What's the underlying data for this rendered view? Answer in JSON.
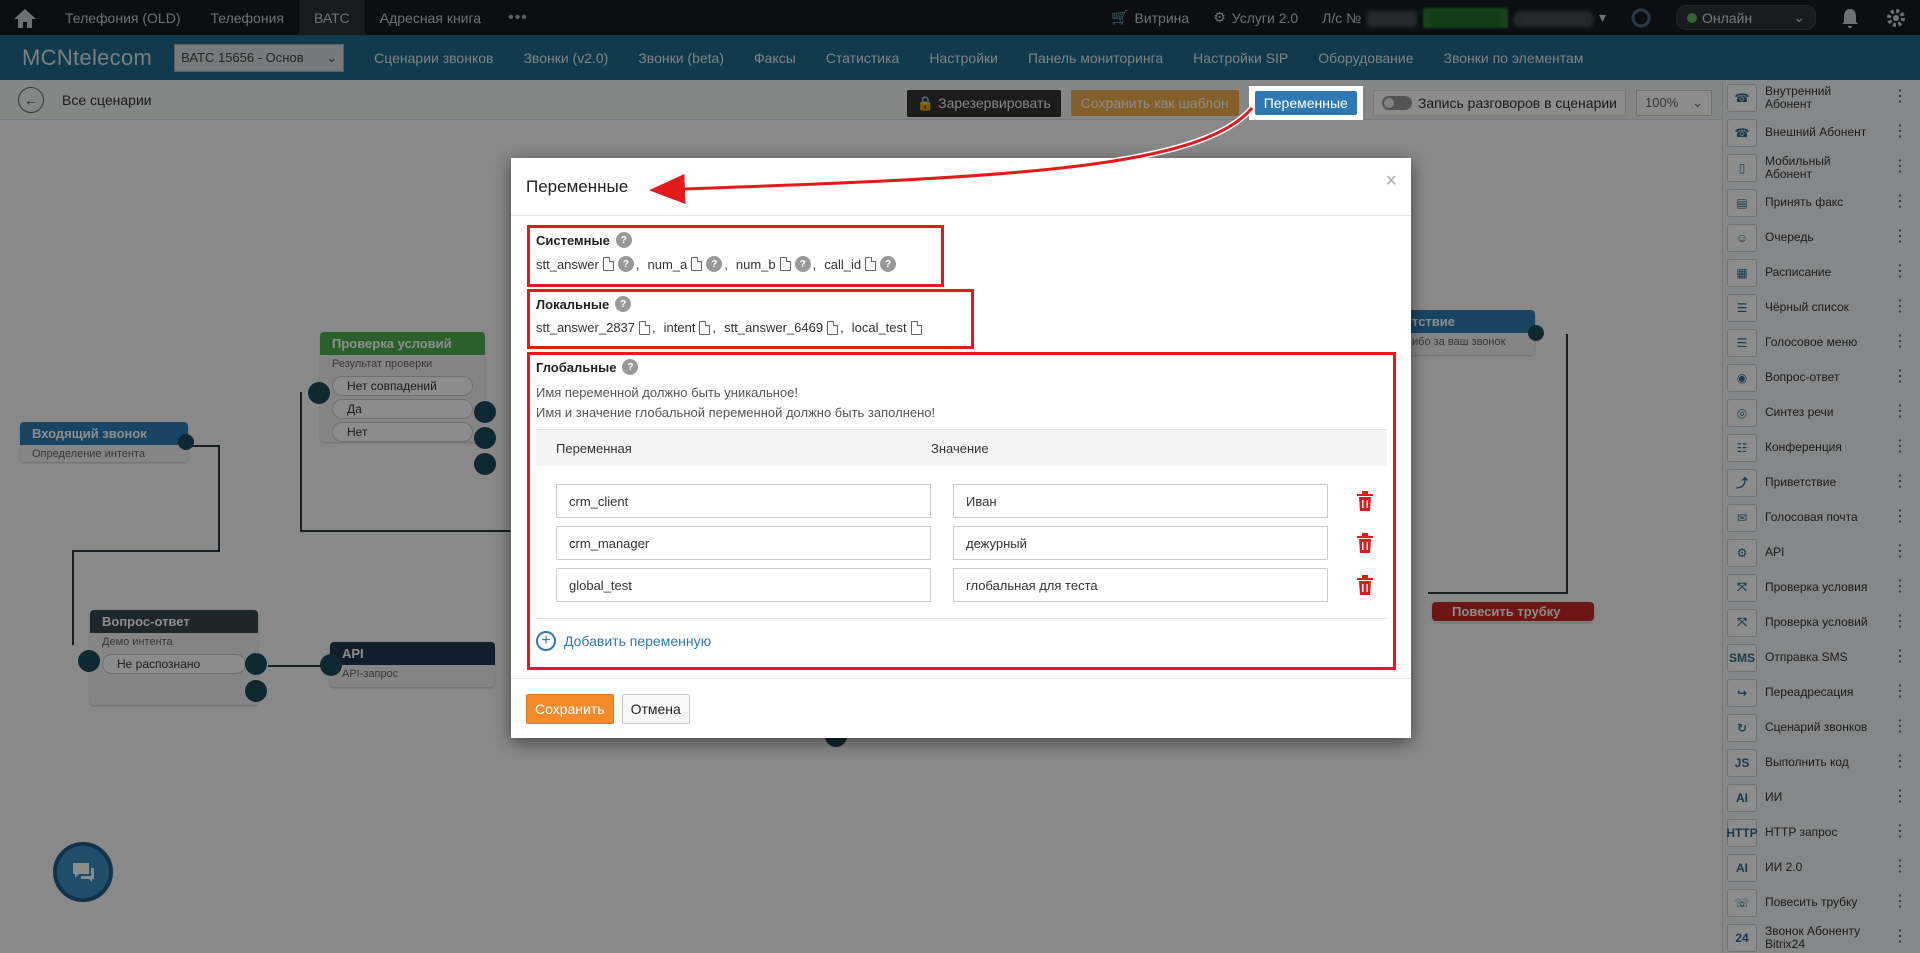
{
  "topbar": {
    "tabs": [
      "Телефония (OLD)",
      "Телефония",
      "ВАТС",
      "Адресная книга"
    ],
    "more": "•••",
    "vitrina": "Витрина",
    "services": "Услуги 2.0",
    "account_label": "Л/с №",
    "status": "Онлайн"
  },
  "nav": {
    "logo": "MCNtelecom",
    "pbx_select": "ВАТС 15656 - Основ",
    "items": [
      "Сценарии звонков",
      "Звонки (v2.0)",
      "Звонки (beta)",
      "Факсы",
      "Статистика",
      "Настройки",
      "Панель мониторинга",
      "Настройки SIP",
      "Оборудование",
      "Звонки по элементам"
    ]
  },
  "toolbar": {
    "all_scenarios": "Все сценарии",
    "reserve": "Зарезервировать",
    "save_template": "Сохранить как шаблон",
    "variables": "Переменные",
    "record": "Запись разговоров в сценарии",
    "zoom": "100%"
  },
  "canvas": {
    "incoming": {
      "title": "Входящий звонок",
      "sub": "Определение интента"
    },
    "conditions": {
      "title": "Проверка условий",
      "sub": "Результат проверки",
      "options": [
        "Нет совпадений",
        "Да",
        "Нет"
      ]
    },
    "qa": {
      "title": "Вопрос-ответ",
      "sub": "Демо интента",
      "options": [
        "Не распознано"
      ]
    },
    "api": {
      "title": "API",
      "sub": "API-запрос"
    },
    "greeting": {
      "title": "тствие",
      "sub": "ибо за ваш звонок"
    },
    "hangup": {
      "title": "Повесить трубку"
    }
  },
  "palette": [
    {
      "label": "Внутренний Абонент",
      "icon": "internal-subscriber-icon"
    },
    {
      "label": "Внешний Абонент",
      "icon": "external-subscriber-icon"
    },
    {
      "label": "Мобильный Абонент",
      "icon": "mobile-subscriber-icon"
    },
    {
      "label": "Принять факс",
      "icon": "fax-icon"
    },
    {
      "label": "Очередь",
      "icon": "queue-icon"
    },
    {
      "label": "Расписание",
      "icon": "schedule-icon"
    },
    {
      "label": "Чёрный список",
      "icon": "blacklist-icon"
    },
    {
      "label": "Голосовое меню",
      "icon": "voice-menu-icon"
    },
    {
      "label": "Вопрос-ответ",
      "icon": "qa-icon"
    },
    {
      "label": "Синтез речи",
      "icon": "tts-icon"
    },
    {
      "label": "Конференция",
      "icon": "conference-icon"
    },
    {
      "label": "Приветствие",
      "icon": "greeting-icon"
    },
    {
      "label": "Голосовая почта",
      "icon": "voicemail-icon"
    },
    {
      "label": "API",
      "icon": "api-icon"
    },
    {
      "label": "Проверка условия",
      "icon": "condition-icon"
    },
    {
      "label": "Проверка условий",
      "icon": "conditions-icon"
    },
    {
      "label": "Отправка SMS",
      "icon": "sms-icon"
    },
    {
      "label": "Переадресация",
      "icon": "redirect-icon"
    },
    {
      "label": "Сценарий звонков",
      "icon": "call-scenario-icon"
    },
    {
      "label": "Выполнить код",
      "icon": "js-icon"
    },
    {
      "label": "ИИ",
      "icon": "ai-icon"
    },
    {
      "label": "HTTP запрос",
      "icon": "http-icon"
    },
    {
      "label": "ИИ 2.0",
      "icon": "ai2-icon"
    },
    {
      "label": "Повесить трубку",
      "icon": "hangup-icon"
    },
    {
      "label": "Звонок Абоненту Bitrix24",
      "icon": "bitrix-icon"
    }
  ],
  "palette_glyphs": [
    "☎",
    "☎",
    "▯",
    "▤",
    "☺",
    "▦",
    "☰",
    "☰",
    "◉",
    "◎",
    "☷",
    "⤴",
    "✉",
    "⚙",
    "⤧",
    "⤧",
    "SMS",
    "↪",
    "↻",
    "JS",
    "AI",
    "HTTP",
    "AI",
    "☏",
    "24"
  ],
  "modal": {
    "title": "Переменные",
    "close": "×",
    "system": {
      "title": "Системные",
      "vars": [
        "stt_answer",
        "num_a",
        "num_b",
        "call_id"
      ]
    },
    "local": {
      "title": "Локальные",
      "vars": [
        "stt_answer_2837",
        "intent",
        "stt_answer_6469",
        "local_test"
      ]
    },
    "global": {
      "title": "Глобальные",
      "note1": "Имя переменной должно быть уникальное!",
      "note2": "Имя и значение глобальной переменной должно быть заполнено!",
      "col_name": "Переменная",
      "col_value": "Значение",
      "rows": [
        {
          "name": "crm_client",
          "value": "Иван"
        },
        {
          "name": "crm_manager",
          "value": "дежурный"
        },
        {
          "name": "global_test",
          "value": "глобальная для теста"
        }
      ],
      "add": "Добавить переменную"
    },
    "save": "Сохранить",
    "cancel": "Отмена"
  },
  "colors": {
    "annotation_red": "#e21a1a",
    "primary_blue": "#2e78b4",
    "save_orange": "#f58a2b",
    "nav_blue": "#1f6b8c"
  }
}
